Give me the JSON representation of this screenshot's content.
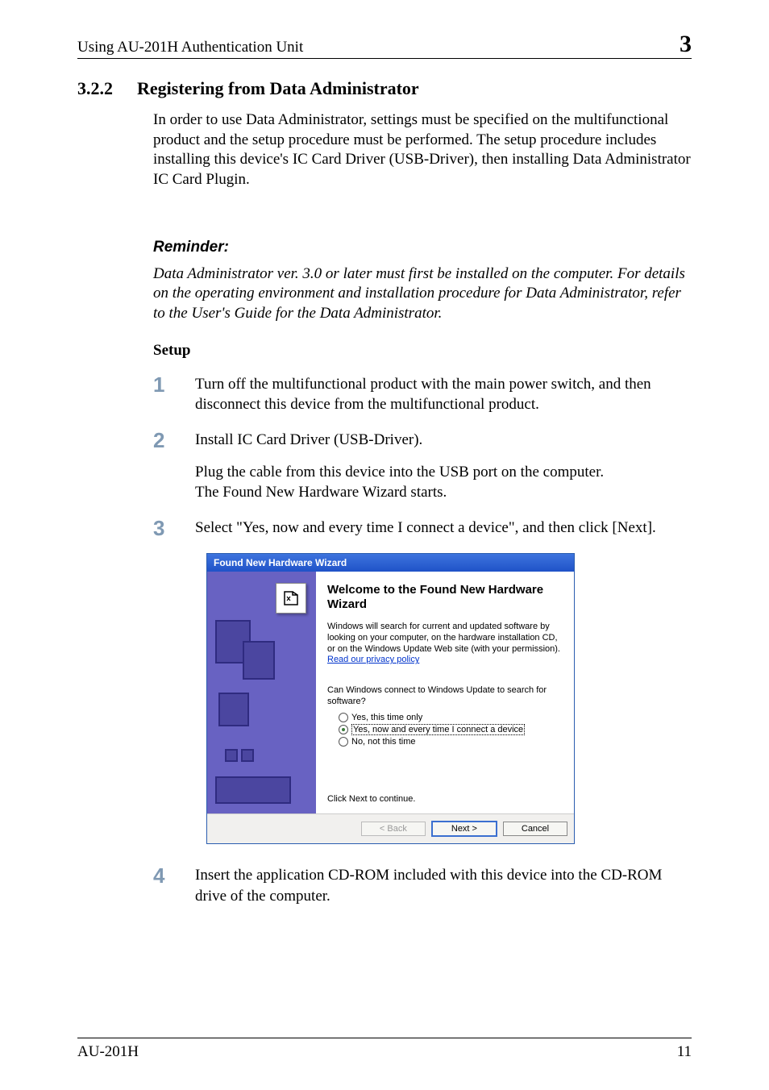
{
  "header": {
    "left": "Using AU-201H Authentication Unit",
    "chapter": "3"
  },
  "section": {
    "number": "3.2.2",
    "title": "Registering from Data Administrator"
  },
  "intro": "In order to use Data Administrator, settings must be specified on the multifunctional product and the setup procedure must be performed. The setup procedure includes installing this device's IC Card Driver (USB-Driver), then installing Data Administrator IC Card Plugin.",
  "reminder": {
    "label": "Reminder:",
    "text": "Data Administrator ver. 3.0 or later must first be installed on the computer. For details on the operating environment and installation procedure for Data Administrator, refer to the User's Guide for the Data Administrator."
  },
  "setup_label": "Setup",
  "steps": {
    "s1": {
      "num": "1",
      "text": "Turn off the multifunctional product with the main power switch, and then disconnect this device from the multifunctional product."
    },
    "s2": {
      "num": "2",
      "text": "Install IC Card Driver (USB-Driver).",
      "sub1": "Plug the cable from this device into the USB port on the computer.",
      "sub2": "The Found New Hardware Wizard starts."
    },
    "s3": {
      "num": "3",
      "text": "Select \"Yes, now and every time I connect a device\", and then click [Next]."
    },
    "s4": {
      "num": "4",
      "text": "Insert the application CD-ROM included with this device into the CD-ROM drive of the computer."
    }
  },
  "wizard": {
    "title": "Found New Hardware Wizard",
    "heading": "Welcome to the Found New Hardware Wizard",
    "desc": "Windows will search for current and updated software by looking on your computer, on the hardware installation CD, or on the Windows Update Web site (with your permission).",
    "privacy_link": "Read our privacy policy",
    "question": "Can Windows connect to Windows Update to search for software?",
    "options": {
      "o1": "Yes, this time only",
      "o2": "Yes, now and every time I connect a device",
      "o3": "No, not this time"
    },
    "continue": "Click Next to continue.",
    "buttons": {
      "back": "< Back",
      "next": "Next >",
      "cancel": "Cancel"
    }
  },
  "footer": {
    "left": "AU-201H",
    "right": "11"
  }
}
